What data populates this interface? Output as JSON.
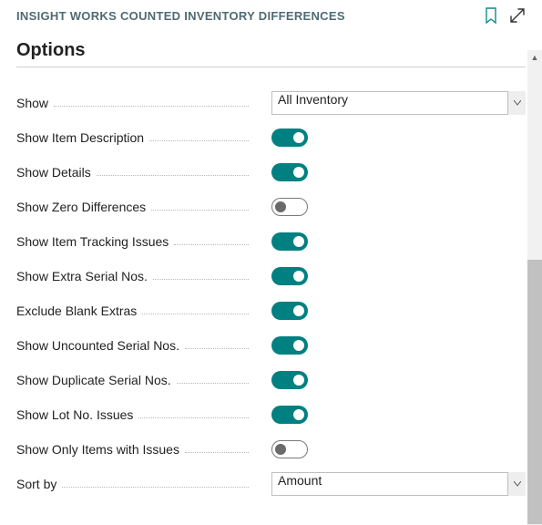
{
  "header": {
    "title": "INSIGHT WORKS COUNTED INVENTORY DIFFERENCES"
  },
  "section_title": "Options",
  "options": {
    "show": {
      "label": "Show",
      "value": "All Inventory"
    },
    "show_item_description": {
      "label": "Show Item Description",
      "value": true
    },
    "show_details": {
      "label": "Show Details",
      "value": true
    },
    "show_zero_differences": {
      "label": "Show Zero Differences",
      "value": false
    },
    "show_item_tracking_issues": {
      "label": "Show Item Tracking Issues",
      "value": true
    },
    "show_extra_serial_nos": {
      "label": "Show Extra Serial Nos.",
      "value": true
    },
    "exclude_blank_extras": {
      "label": "Exclude Blank Extras",
      "value": true
    },
    "show_uncounted_serial_nos": {
      "label": "Show Uncounted Serial Nos.",
      "value": true
    },
    "show_duplicate_serial_nos": {
      "label": "Show Duplicate Serial Nos.",
      "value": true
    },
    "show_lot_no_issues": {
      "label": "Show Lot No. Issues",
      "value": true
    },
    "show_only_items_with_issues": {
      "label": "Show Only Items with Issues",
      "value": false
    },
    "sort_by": {
      "label": "Sort by",
      "value": "Amount"
    }
  }
}
